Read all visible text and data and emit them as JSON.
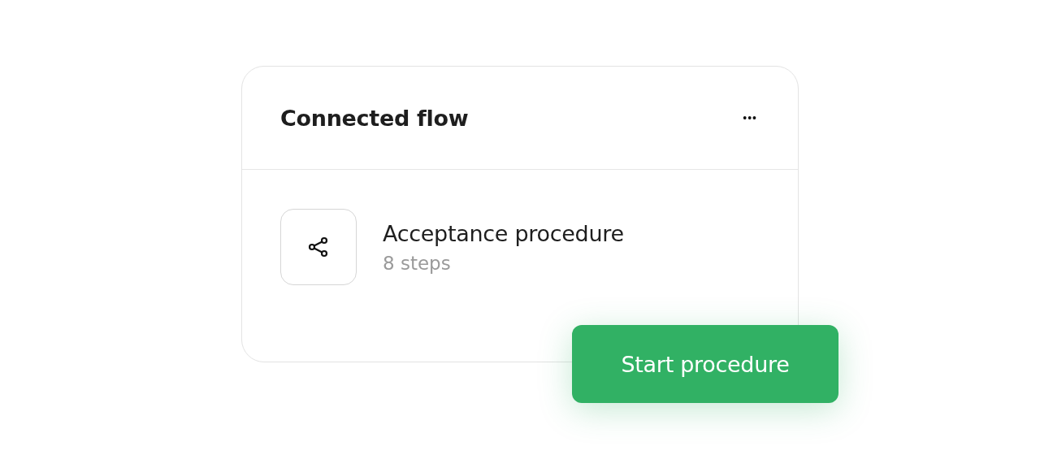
{
  "card": {
    "title": "Connected flow",
    "menu": "•••"
  },
  "flow": {
    "name": "Acceptance procedure",
    "steps": "8 steps"
  },
  "action": {
    "label": "Start procedure"
  }
}
